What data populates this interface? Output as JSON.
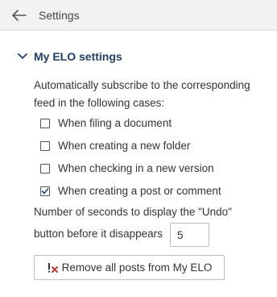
{
  "header": {
    "title": "Settings",
    "back_icon": "arrow-left-icon"
  },
  "section": {
    "title": "My ELO settings",
    "expanded": true
  },
  "description": {
    "line1": "Automatically subscribe to the corresponding",
    "line2": "feed in the following cases:"
  },
  "options": [
    {
      "label": "When filing a document",
      "checked": false
    },
    {
      "label": "When creating a new folder",
      "checked": false
    },
    {
      "label": "When checking in a new version",
      "checked": false
    },
    {
      "label": "When creating a post or comment",
      "checked": true
    }
  ],
  "undo": {
    "line1": "Number of seconds to display the \"Undo\"",
    "line2": "button before it disappears",
    "value": "5"
  },
  "remove_button": {
    "label": "Remove all posts from My ELO",
    "icon": "remove-posts-icon"
  },
  "colors": {
    "accent": "#1f3f66",
    "header_bg": "#f2f2f2",
    "icon_red": "#c0392b"
  }
}
